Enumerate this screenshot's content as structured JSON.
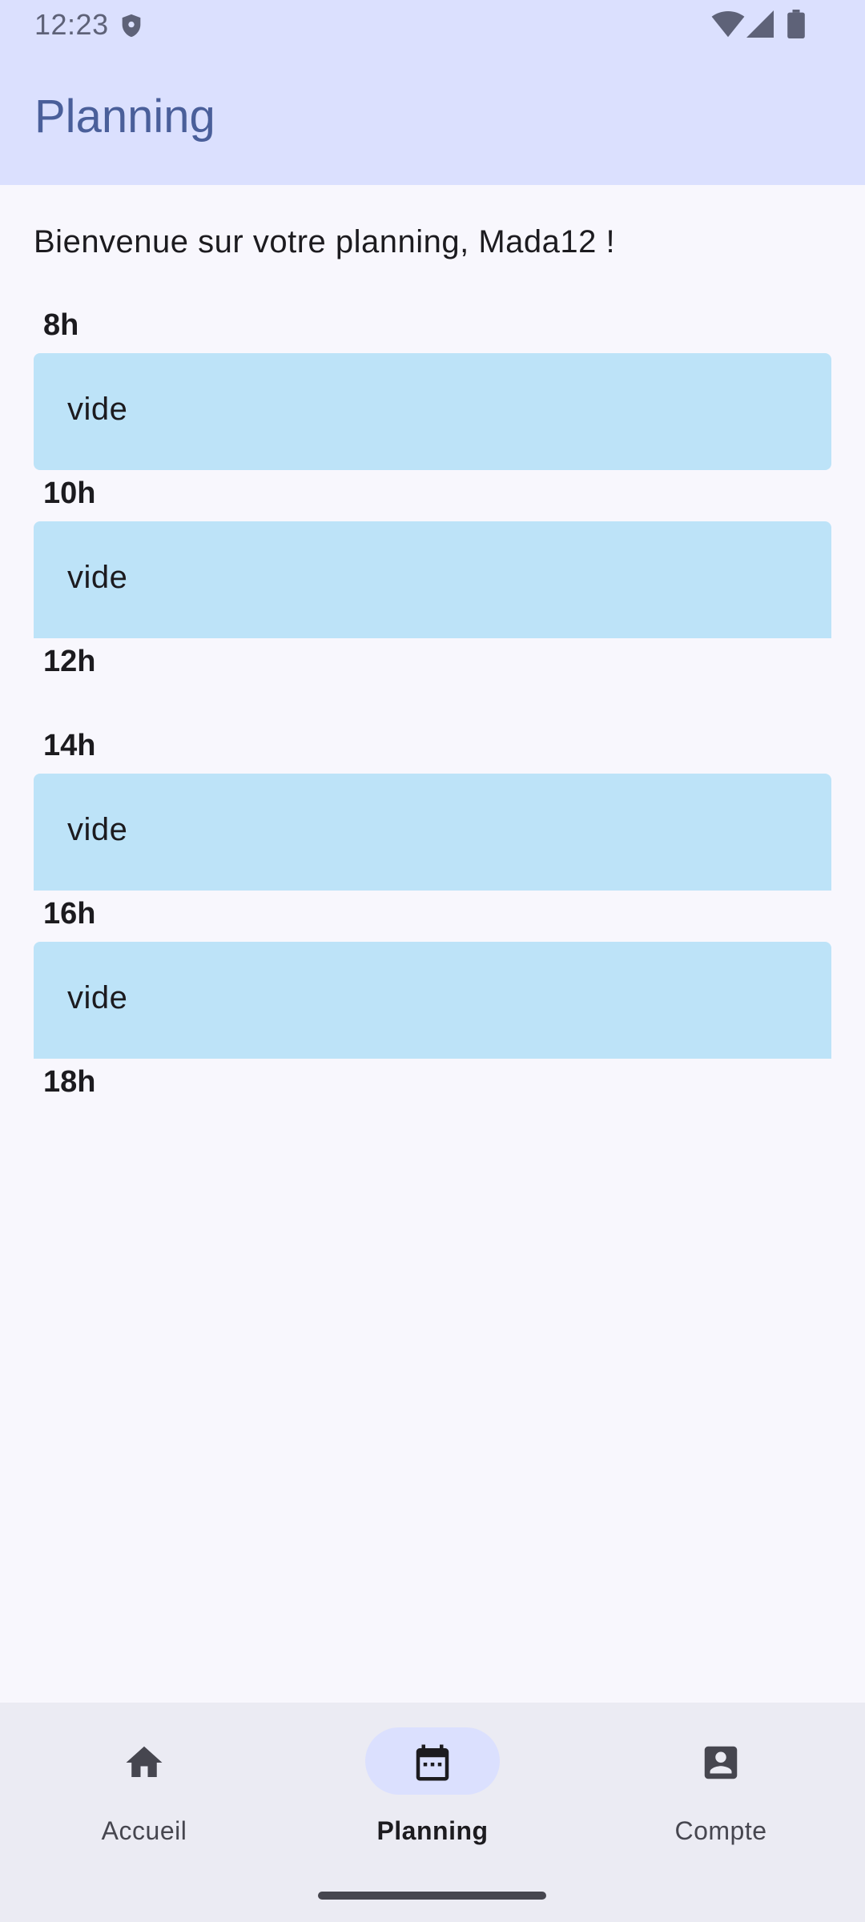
{
  "status_bar": {
    "time": "12:23",
    "icons": [
      "shield-icon",
      "wifi-icon",
      "signal-icon",
      "battery-icon"
    ]
  },
  "app_bar": {
    "title": "Planning"
  },
  "welcome_text": "Bienvenue sur votre planning, Mada12 !",
  "schedule": [
    {
      "hour": "8h",
      "slot": "vide"
    },
    {
      "hour": "10h",
      "slot": "vide"
    },
    {
      "hour": "12h",
      "slot": null
    },
    {
      "hour": "14h",
      "slot": "vide"
    },
    {
      "hour": "16h",
      "slot": "vide"
    },
    {
      "hour": "18h",
      "slot": null
    }
  ],
  "bottom_nav": {
    "items": [
      {
        "label": "Accueil",
        "icon": "home-icon",
        "active": false
      },
      {
        "label": "Planning",
        "icon": "calendar-icon",
        "active": true
      },
      {
        "label": "Compte",
        "icon": "account-icon",
        "active": false
      }
    ]
  },
  "colors": {
    "header_bg": "#dbe0fe",
    "title": "#4a5f9a",
    "slot_bg": "#bde3f8",
    "page_bg": "#f8f7fd",
    "nav_bg": "#ebebf3"
  }
}
